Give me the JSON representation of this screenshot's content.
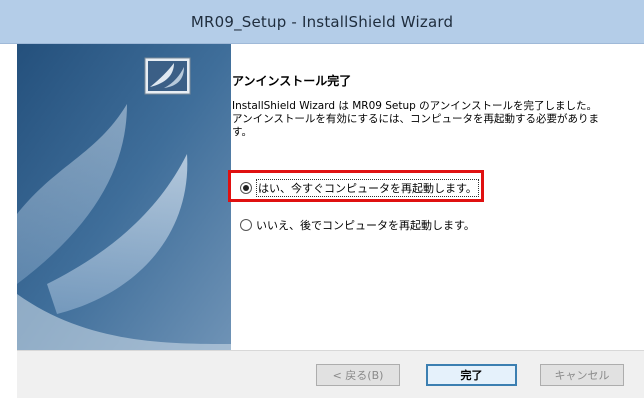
{
  "window": {
    "title": "MR09_Setup - InstallShield Wizard"
  },
  "icons": {
    "setup_logo": "installshield-logo-icon"
  },
  "content": {
    "heading": "アンインストール完了",
    "message": "InstallShield Wizard は MR09 Setup のアンインストールを完了しました。\nアンインストールを有効にするには、コンピュータを再起動する必要がありま\nす。"
  },
  "options": [
    {
      "label": "はい、今すぐコンピュータを再起動します。",
      "selected": true
    },
    {
      "label": "いいえ、後でコンピュータを再起動します。",
      "selected": false
    }
  ],
  "buttons": {
    "back": "< 戻る(B)",
    "finish": "完了",
    "cancel": "キャンセル"
  },
  "colors": {
    "title_bar": "#b4cde8",
    "side_panel": "#3f6e9a",
    "highlight": "#e01010"
  }
}
